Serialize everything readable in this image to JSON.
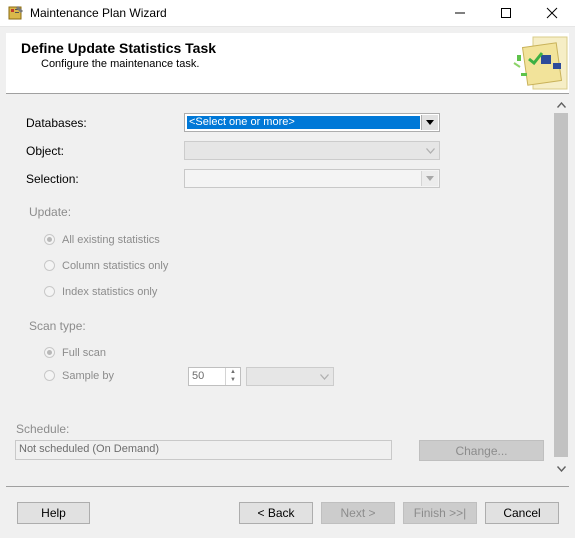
{
  "window": {
    "title": "Maintenance Plan Wizard"
  },
  "header": {
    "title": "Define Update Statistics Task",
    "subtitle": "Configure the maintenance task."
  },
  "form": {
    "databases_label": "Databases:",
    "databases_value": "<Select one or more>",
    "object_label": "Object:",
    "object_value": "",
    "selection_label": "Selection:",
    "selection_value": "",
    "update_label": "Update:",
    "update_options": [
      {
        "label": "All existing statistics",
        "selected": true
      },
      {
        "label": "Column statistics only",
        "selected": false
      },
      {
        "label": "Index statistics only",
        "selected": false
      }
    ],
    "scan_type_label": "Scan type:",
    "scan_options": [
      {
        "label": "Full scan",
        "selected": true
      },
      {
        "label": "Sample by",
        "selected": false
      }
    ],
    "sample_value": "50",
    "sample_unit_value": "",
    "schedule_label": "Schedule:",
    "schedule_value": "Not scheduled (On Demand)",
    "change_button": "Change..."
  },
  "footer": {
    "help": "Help",
    "back": "< Back",
    "next": "Next >",
    "finish": "Finish >>|",
    "cancel": "Cancel"
  },
  "icons": {
    "app": "wizard-icon",
    "minimize": "minimize-icon",
    "maximize": "maximize-icon",
    "close": "close-icon",
    "header_graphic": "task-graphic-icon"
  },
  "colors": {
    "selection_highlight": "#0078d7",
    "disabled_text": "#8c8c8c"
  }
}
